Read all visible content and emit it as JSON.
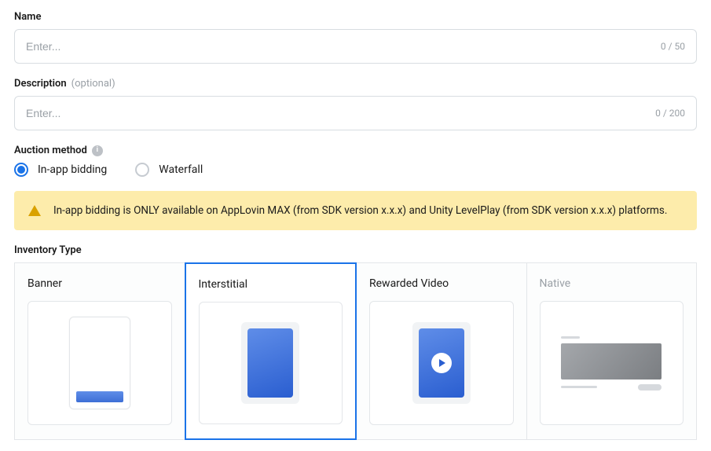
{
  "name_field": {
    "label": "Name",
    "placeholder": "Enter...",
    "value": "",
    "counter": "0 / 50"
  },
  "description_field": {
    "label": "Description",
    "optional": "(optional)",
    "placeholder": "Enter...",
    "value": "",
    "counter": "0 / 200"
  },
  "auction": {
    "label": "Auction method",
    "options": {
      "in_app": "In-app bidding",
      "waterfall": "Waterfall"
    },
    "selected": "in_app"
  },
  "notice": {
    "text": "In-app bidding is ONLY available on AppLovin MAX (from SDK version x.x.x) and Unity LevelPlay (from SDK version x.x.x) platforms."
  },
  "inventory": {
    "label": "Inventory Type",
    "types": {
      "banner": "Banner",
      "interstitial": "Interstitial",
      "rewarded": "Rewarded Video",
      "native": "Native"
    },
    "selected": "interstitial",
    "disabled": [
      "native"
    ]
  }
}
